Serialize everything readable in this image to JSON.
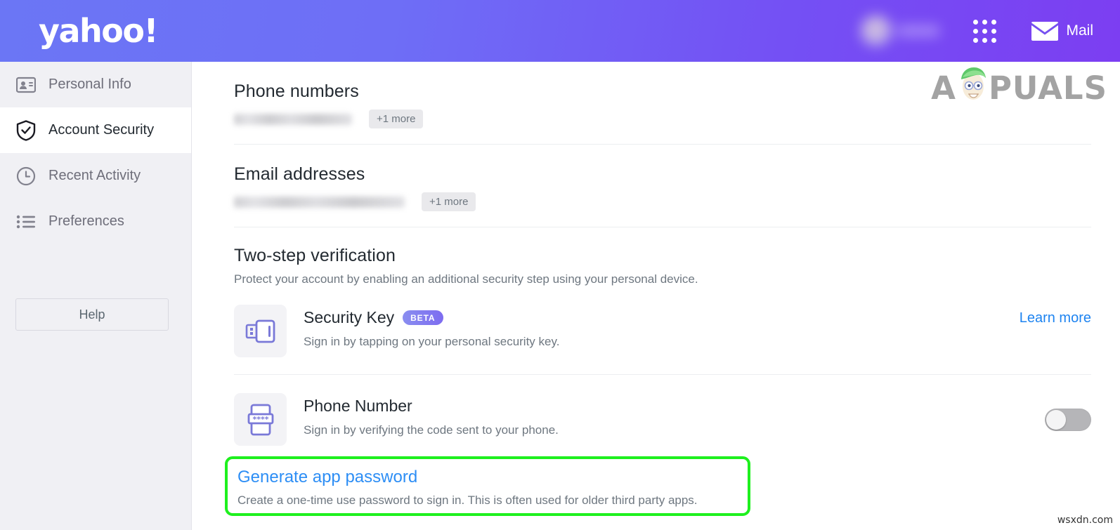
{
  "header": {
    "logo_text": "yahoo!",
    "avatar_icon": "avatar-blurred",
    "apps_icon": "apps-grid-icon",
    "mail_icon": "mail-envelope-icon",
    "mail_label": "Mail",
    "gradient_start": "#6b76f5",
    "gradient_end": "#7c3ef2"
  },
  "sidebar": {
    "items": [
      {
        "label": "Personal Info",
        "icon": "contact-card-icon",
        "active": false
      },
      {
        "label": "Account Security",
        "icon": "shield-check-icon",
        "active": true
      },
      {
        "label": "Recent Activity",
        "icon": "clock-icon",
        "active": false
      },
      {
        "label": "Preferences",
        "icon": "list-icon",
        "active": false
      }
    ],
    "help_label": "Help"
  },
  "main": {
    "phone_numbers": {
      "title": "Phone numbers",
      "value_masked": "",
      "more_badge": "+1 more"
    },
    "email_addresses": {
      "title": "Email addresses",
      "value_masked": "",
      "more_badge": "+1 more"
    },
    "two_step": {
      "title": "Two-step verification",
      "description": "Protect your account by enabling an additional security step using your personal device.",
      "methods": [
        {
          "icon": "security-key-usb-icon",
          "title": "Security Key",
          "badge": "BETA",
          "description": "Sign in by tapping on your personal security key.",
          "action_label": "Learn more",
          "action_type": "link",
          "action_color": "#1d83f0"
        },
        {
          "icon": "phone-passcode-icon",
          "title": "Phone Number",
          "badge": "",
          "description": "Sign in by verifying the code sent to your phone.",
          "action_label": "",
          "action_type": "toggle",
          "toggle_state": "off"
        }
      ]
    },
    "app_password": {
      "link_label": "Generate app password",
      "description": "Create a one-time use password to sign in. This is often used for older third party apps.",
      "highlight_color": "#1ef01e",
      "link_color": "#2d8ef5"
    }
  },
  "watermarks": {
    "brand_a": "A",
    "brand_rest": "PUALS",
    "mascot_icon": "appuals-mascot-icon",
    "site": "wsxdn.com"
  }
}
